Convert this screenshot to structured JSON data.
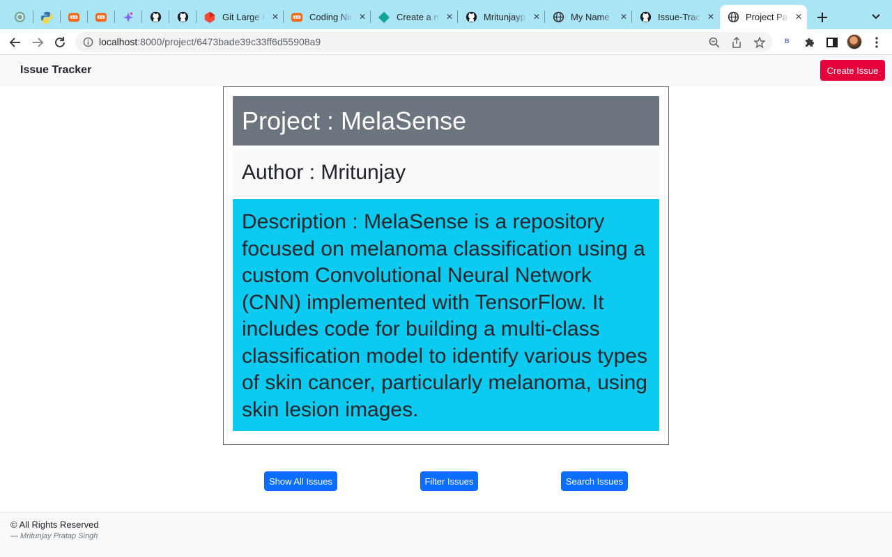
{
  "browser": {
    "tabs": [
      {
        "label": "",
        "icon": "chatgpt-icon"
      },
      {
        "label": "",
        "icon": "python-icon"
      },
      {
        "label": "",
        "icon": "coding-ninjas-icon"
      },
      {
        "label": "",
        "icon": "coding-ninjas-icon"
      },
      {
        "label": "",
        "icon": "gemini-sparkle-icon"
      },
      {
        "label": "",
        "icon": "github-icon"
      },
      {
        "label": "",
        "icon": "github-icon"
      },
      {
        "label": "Git Large F",
        "icon": "git-lfs-icon"
      },
      {
        "label": "Coding Nin",
        "icon": "coding-ninjas-icon"
      },
      {
        "label": "Create a ne",
        "icon": "diamond-icon"
      },
      {
        "label": "Mritunjayp",
        "icon": "github-icon"
      },
      {
        "label": "My Name",
        "icon": "globe-icon"
      },
      {
        "label": "Issue-Trac",
        "icon": "github-icon"
      },
      {
        "label": "Project Pag",
        "icon": "globe-icon",
        "active": true
      }
    ],
    "url_host": "localhost",
    "url_path": ":8000/project/6473bade39c33ff6d55908a9",
    "extension_label": "B"
  },
  "navbar": {
    "brand": "Issue Tracker",
    "create_button": "Create Issue"
  },
  "project": {
    "title": "Project : MelaSense",
    "author": "Author : Mritunjay",
    "description": "Description : MelaSense is a repository focused on melanoma classification using a custom Convolutional Neural Network (CNN) implemented with TensorFlow. It includes code for building a multi-class classification model to identify various types of skin cancer, particularly melanoma, using skin lesion images."
  },
  "actions": {
    "show_all": "Show All Issues",
    "filter": "Filter Issues",
    "search": "Search Issues"
  },
  "footer": {
    "rights": "© All Rights Reserved",
    "signature": "— Mritunjay Pratap Singh"
  },
  "colors": {
    "tabstrip": "#a9e5f5",
    "create_button": "#e5023a",
    "primary_button": "#0d6efd",
    "title_bg": "#6c757d",
    "description_bg": "#0dcaf0"
  }
}
